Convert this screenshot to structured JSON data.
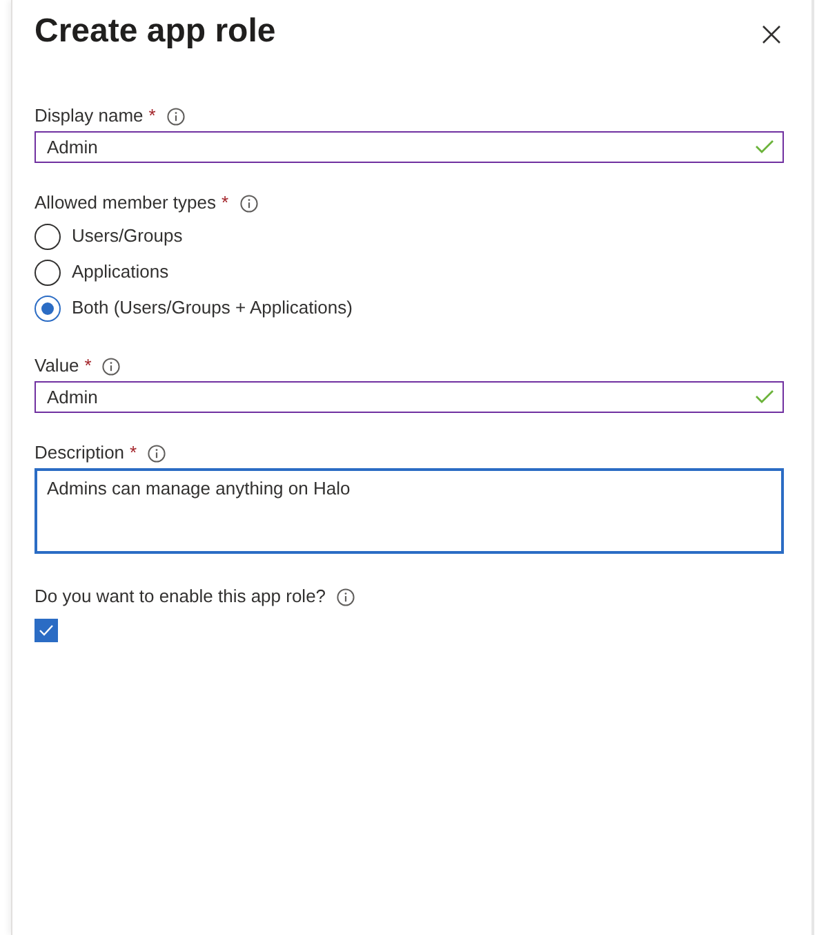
{
  "title": "Create app role",
  "fields": [
    {
      "kind": "text",
      "label": "Display name",
      "required_mark": "*",
      "value": "Admin",
      "valid": true,
      "focused": false
    },
    {
      "kind": "radio",
      "label": "Allowed member types",
      "required_mark": "*",
      "options": [
        {
          "label": "Users/Groups",
          "selected": false
        },
        {
          "label": "Applications",
          "selected": false
        },
        {
          "label": "Both (Users/Groups + Applications)",
          "selected": true
        }
      ]
    },
    {
      "kind": "text",
      "label": "Value",
      "required_mark": "*",
      "value": "Admin",
      "valid": true,
      "focused": false
    },
    {
      "kind": "textarea",
      "label": "Description",
      "required_mark": "*",
      "value": "Admins can manage anything on Halo",
      "valid": false,
      "focused": true
    },
    {
      "kind": "checkbox",
      "label": "Do you want to enable this app role?",
      "checked": true
    }
  ]
}
